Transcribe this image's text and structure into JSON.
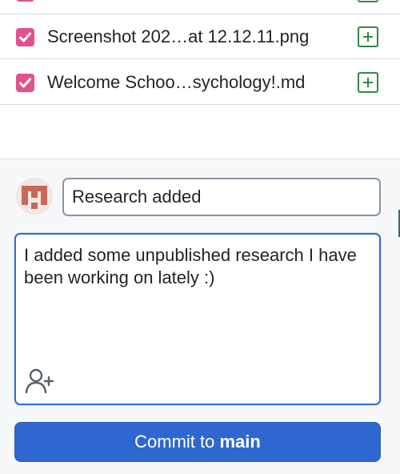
{
  "changes": {
    "files": [
      {
        "name": "",
        "checked": true,
        "status": "added"
      },
      {
        "name": "Screenshot 202…at 12.12.11.png",
        "checked": true,
        "status": "added"
      },
      {
        "name": "Welcome Schoo…sychology!.md",
        "checked": true,
        "status": "added"
      }
    ]
  },
  "commit": {
    "summary_value": "Research added",
    "description": "I added some unpublished research I have been working on lately :)",
    "button_prefix": "Commit to ",
    "branch": "main"
  },
  "icons": {
    "checkbox": "checkbox-checked-icon",
    "status": "plus-square-icon",
    "avatar": "identicon-avatar",
    "coauthor": "person-add-icon"
  },
  "colors": {
    "checkbox": "#e1528c",
    "added": "#2e8a47",
    "focus": "#2f6fd6",
    "button": "#2f67d0"
  }
}
